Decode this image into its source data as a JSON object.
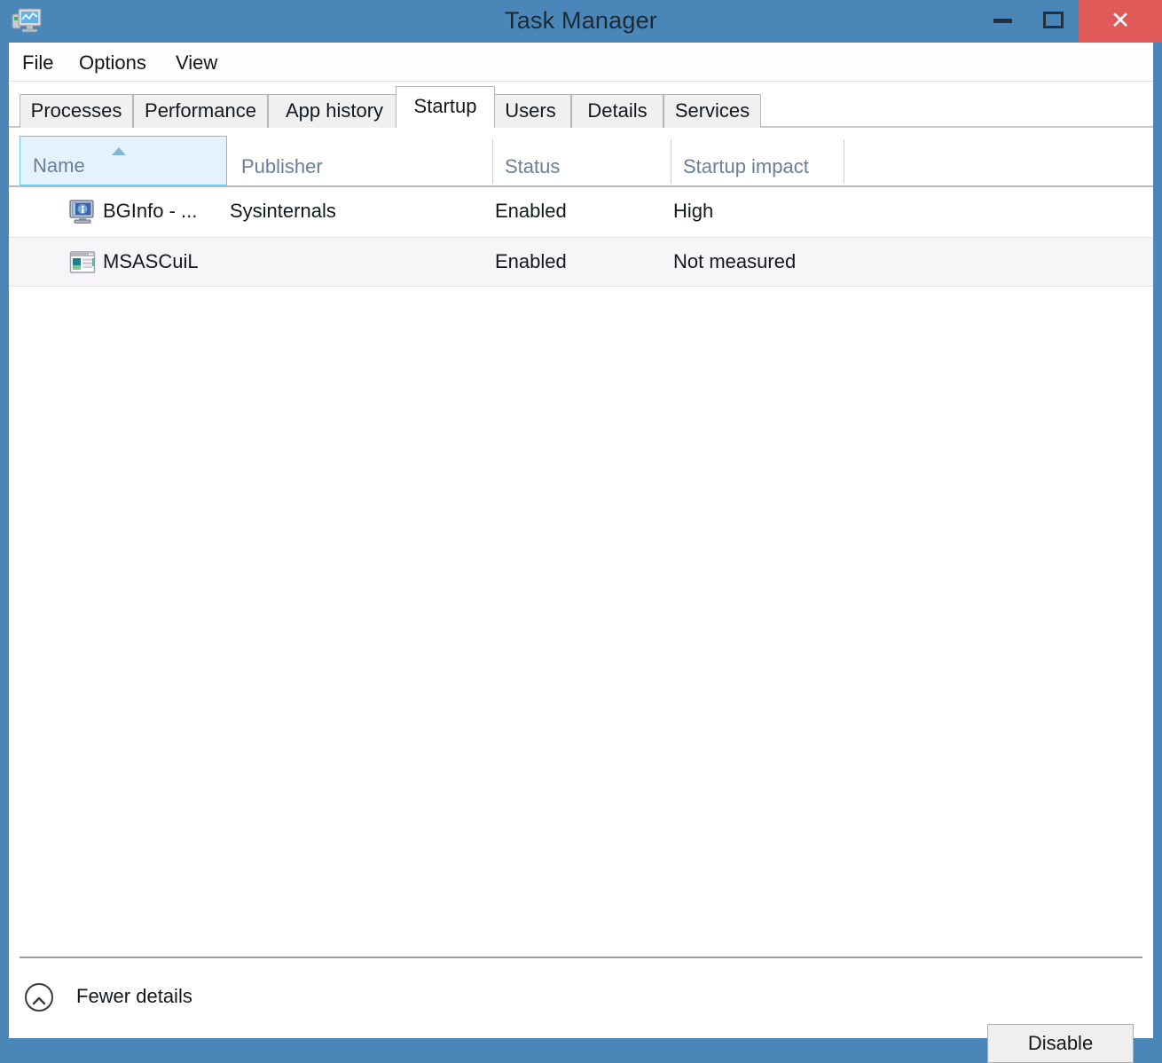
{
  "window": {
    "title": "Task Manager",
    "app_icon": "task-manager-monitor-icon",
    "accent_color": "#4a86b8",
    "close_color": "#e05a5a",
    "controls": {
      "minimize": "minimize-icon",
      "maximize": "maximize-icon",
      "close": "✕"
    }
  },
  "menubar": {
    "items": [
      {
        "label": "File"
      },
      {
        "label": "Options"
      },
      {
        "label": "View"
      }
    ]
  },
  "tabs": {
    "active": "Startup",
    "items": [
      {
        "label": "Processes",
        "active": false
      },
      {
        "label": "Performance",
        "active": false
      },
      {
        "label": "App history",
        "active": false
      },
      {
        "label": "Startup",
        "active": true
      },
      {
        "label": "Users",
        "active": false
      },
      {
        "label": "Details",
        "active": false
      },
      {
        "label": "Services",
        "active": false
      }
    ]
  },
  "table": {
    "sort_column": "Name",
    "sort_direction": "ascending",
    "columns": [
      {
        "label": "Name"
      },
      {
        "label": "Publisher"
      },
      {
        "label": "Status"
      },
      {
        "label": "Startup impact"
      }
    ],
    "rows": [
      {
        "icon": "bginfo-monitor-icon",
        "name": "BGInfo - ...",
        "publisher": "Sysinternals",
        "status": "Enabled",
        "impact": "High"
      },
      {
        "icon": "msascuil-window-icon",
        "name": "MSASCuiL",
        "publisher": "",
        "status": "Enabled",
        "impact": "Not measured"
      }
    ]
  },
  "footer": {
    "fewer_details_label": "Fewer details",
    "fewer_details_icon": "chevron-up-circle-icon",
    "disable_label": "Disable"
  }
}
